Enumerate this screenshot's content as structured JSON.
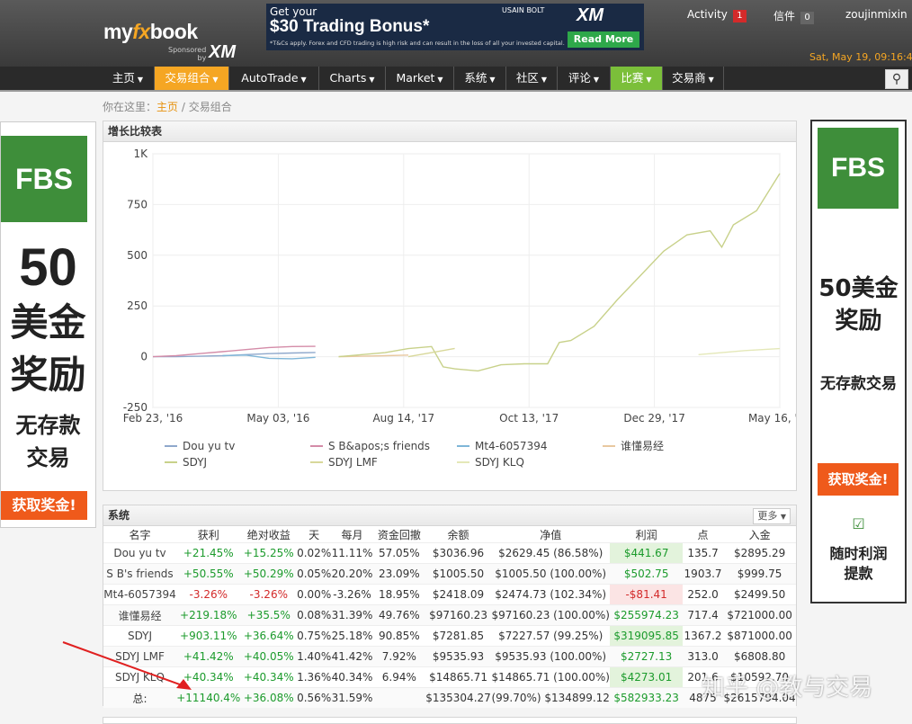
{
  "header": {
    "logo_pre": "my",
    "logo_fx": "fx",
    "logo_post": "book",
    "sponsored_label": "Sponsored",
    "sponsored_by": "by",
    "sponsor_logo": "XM",
    "date": "Sat, May 19, 09:16:4"
  },
  "banner": {
    "line1": "Get your",
    "line2": "$30 Trading Bonus*",
    "disclaimer": "*T&Cs apply. Forex and CFD trading is high risk and can result in the loss of all your invested capital.",
    "usain": "USAIN BOLT",
    "brand": "XM",
    "cta": "Read More"
  },
  "user": {
    "activity_label": "Activity",
    "activity_count": "1",
    "messages_label": "信件",
    "messages_count": "0",
    "username": "zoujinmixin"
  },
  "nav": {
    "items": [
      {
        "label": "主页"
      },
      {
        "label": "交易组合"
      },
      {
        "label": "AutoTrade"
      },
      {
        "label": "Charts"
      },
      {
        "label": "Market"
      },
      {
        "label": "系统"
      },
      {
        "label": "社区"
      },
      {
        "label": "评论"
      },
      {
        "label": "比赛"
      },
      {
        "label": "交易商"
      }
    ]
  },
  "breadcrumb": {
    "prefix": "你在这里：",
    "home": "主页",
    "separator": " / ",
    "current": "交易组合"
  },
  "ads": {
    "left": {
      "logo": "FBS",
      "amount": "50",
      "line1": "美金",
      "line2": "奖励",
      "line3": "无存款",
      "line4": "交易",
      "cta": "获取奖金!"
    },
    "right": {
      "logo": "FBS",
      "line1": "50美金",
      "line2": "奖励",
      "line3": "无存款交易",
      "cta": "获取奖金!",
      "line4": "随时利润",
      "line5": "提款"
    }
  },
  "chart_panel": {
    "title": "增长比较表"
  },
  "chart_data": {
    "type": "line",
    "title": "",
    "xlabel": "",
    "ylabel": "",
    "y_ticks": [
      "1K",
      "750",
      "500",
      "250",
      "0",
      "-250"
    ],
    "ylim": [
      -250,
      1000
    ],
    "x_ticks": [
      "Feb 23, '16",
      "May 03, '16",
      "Aug 14, '17",
      "Oct 13, '17",
      "Dec 29, '17",
      "May 16, '18"
    ],
    "grid": true,
    "legend_position": "bottom",
    "series": [
      {
        "name": "Dou yu tv",
        "color": "#8fa8cc",
        "points": [
          [
            0,
            0
          ],
          [
            1,
            0
          ],
          [
            2,
            2
          ],
          [
            3,
            5
          ],
          [
            4,
            10
          ],
          [
            5,
            15
          ],
          [
            6,
            18
          ],
          [
            7,
            21
          ]
        ]
      },
      {
        "name": "S B&apos;s friends",
        "color": "#d48ca8",
        "points": [
          [
            0,
            0
          ],
          [
            1,
            5
          ],
          [
            2,
            15
          ],
          [
            3,
            25
          ],
          [
            4,
            35
          ],
          [
            5,
            45
          ],
          [
            6,
            50
          ],
          [
            7,
            51
          ]
        ]
      },
      {
        "name": "Mt4-6057394",
        "color": "#7fb6d8",
        "points": [
          [
            3,
            5
          ],
          [
            4,
            8
          ],
          [
            5,
            -8
          ],
          [
            6,
            -10
          ],
          [
            7,
            -3
          ]
        ]
      },
      {
        "name": "谁懂易经",
        "color": "#e8c8a0",
        "points": [
          [
            8,
            0
          ],
          [
            9,
            2
          ],
          [
            10,
            5
          ],
          [
            11,
            8
          ]
        ]
      },
      {
        "name": "SDYJ",
        "color": "#c8d18a",
        "points": [
          [
            8,
            0
          ],
          [
            9,
            10
          ],
          [
            10,
            20
          ],
          [
            11,
            40
          ],
          [
            12,
            50
          ],
          [
            12.5,
            -50
          ],
          [
            13,
            -60
          ],
          [
            14,
            -70
          ],
          [
            15,
            -40
          ],
          [
            16,
            -35
          ],
          [
            17,
            -35
          ],
          [
            17.5,
            70
          ],
          [
            18,
            80
          ],
          [
            19,
            150
          ],
          [
            20,
            280
          ],
          [
            21,
            400
          ],
          [
            22,
            520
          ],
          [
            23,
            600
          ],
          [
            24,
            620
          ],
          [
            24.5,
            540
          ],
          [
            25,
            650
          ],
          [
            26,
            720
          ],
          [
            27,
            903
          ]
        ]
      },
      {
        "name": "SDYJ LMF",
        "color": "#d8d89a",
        "points": [
          [
            11,
            0
          ],
          [
            12,
            20
          ],
          [
            13,
            41
          ]
        ]
      },
      {
        "name": "SDYJ KLQ",
        "color": "#e4e8b8",
        "points": [
          [
            23.5,
            10
          ],
          [
            24.5,
            20
          ],
          [
            25.5,
            30
          ],
          [
            27,
            40
          ]
        ]
      }
    ]
  },
  "systems_panel": {
    "title": "系统",
    "more_label": "更多",
    "columns": [
      "名字",
      "获利",
      "绝对收益",
      "天",
      "每月",
      "资金回撤",
      "余额",
      "净值",
      "利润",
      "点",
      "入金"
    ],
    "rows": [
      [
        "Dou yu tv",
        "+21.45%",
        "+15.25%",
        "0.02%",
        "11.11%",
        "57.05%",
        "$3036.96",
        "$2629.45 (86.58%)",
        "$441.67",
        "135.7",
        "$2895.29"
      ],
      [
        "S B's friends",
        "+50.55%",
        "+50.29%",
        "0.05%",
        "20.20%",
        "23.09%",
        "$1005.50",
        "$1005.50 (100.00%)",
        "$502.75",
        "1903.7",
        "$999.75"
      ],
      [
        "Mt4-6057394",
        "-3.26%",
        "-3.26%",
        "0.00%",
        "-3.26%",
        "18.95%",
        "$2418.09",
        "$2474.73 (102.34%)",
        "-$81.41",
        "252.0",
        "$2499.50"
      ],
      [
        "谁懂易经",
        "+219.18%",
        "+35.5%",
        "0.08%",
        "31.39%",
        "49.76%",
        "$97160.23",
        "$97160.23 (100.00%)",
        "$255974.23",
        "717.4",
        "$721000.00"
      ],
      [
        "SDYJ",
        "+903.11%",
        "+36.64%",
        "0.75%",
        "25.18%",
        "90.85%",
        "$7281.85",
        "$7227.57 (99.25%)",
        "$319095.85",
        "1367.2",
        "$871000.00"
      ],
      [
        "SDYJ LMF",
        "+41.42%",
        "+40.05%",
        "1.40%",
        "41.42%",
        "7.92%",
        "$9535.93",
        "$9535.93 (100.00%)",
        "$2727.13",
        "313.0",
        "$6808.80"
      ],
      [
        "SDYJ KLQ",
        "+40.34%",
        "+40.34%",
        "1.36%",
        "40.34%",
        "6.94%",
        "$14865.71",
        "$14865.71 (100.00%)",
        "$4273.01",
        "201.6",
        "$10592.70"
      ]
    ],
    "total": [
      "总:",
      "+11140.4%",
      "+36.08%",
      "0.56%",
      "31.59%",
      "",
      "$135304.27",
      "(99.70%) $134899.12",
      "$582933.23",
      "4875",
      "$2615794.04"
    ]
  },
  "watermark": "知乎 @教与交易"
}
